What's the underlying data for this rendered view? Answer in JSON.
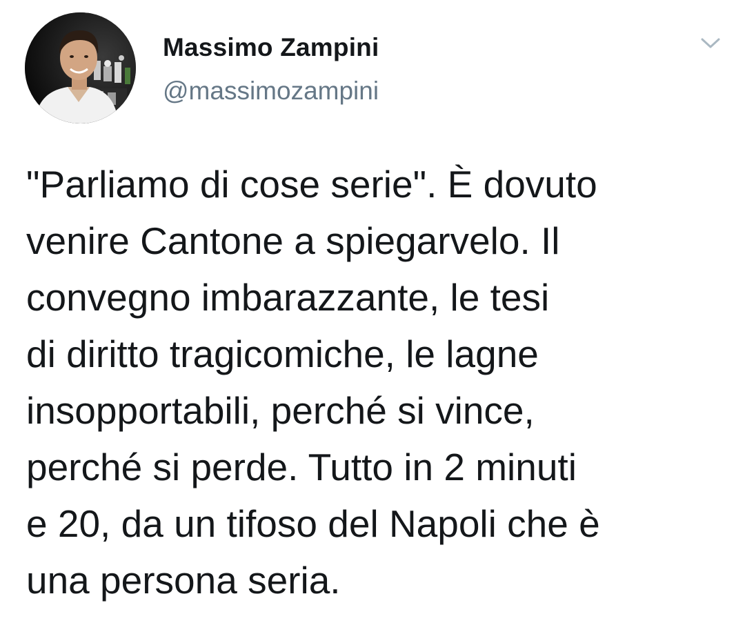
{
  "author": {
    "display_name": "Massimo Zampini",
    "handle": "@massimozampini",
    "avatar_icon": "profile-photo"
  },
  "menu": {
    "caret_icon": "chevron-down-icon"
  },
  "tweet": {
    "lines": [
      "\"Parliamo di cose serie\". È dovuto",
      "venire Cantone a spiegarvelo. Il",
      "convegno imbarazzante, le tesi",
      "di diritto tragicomiche, le lagne",
      "insopportabili, perché si vince,",
      "perché si perde. Tutto in 2 minuti",
      "e 20, da un tifoso del Napoli che è",
      "una persona seria."
    ]
  },
  "colors": {
    "text": "#14171a",
    "secondary": "#657786",
    "caret": "#aab8c2",
    "background": "#ffffff"
  }
}
